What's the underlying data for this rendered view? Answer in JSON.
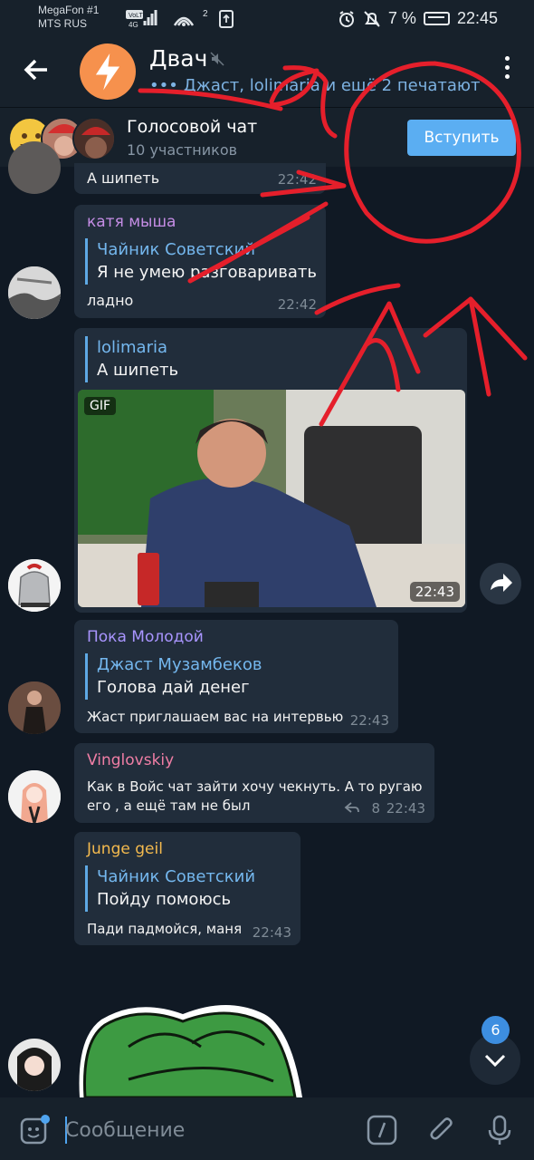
{
  "status_bar": {
    "carrier_1": "MegaFon #1",
    "carrier_2": "MTS RUS",
    "volte": "VoLTE",
    "network": "4G",
    "sim_badge": "2",
    "battery": "7 %",
    "time": "22:45"
  },
  "header": {
    "title": "Двач",
    "typing_status": "••• Джаст, lolimaria и ещё 2 печатают"
  },
  "voice_chat": {
    "title": "Голосовой чат",
    "participants": "10 участников",
    "join_label": "Вступить"
  },
  "messages": [
    {
      "id": "m0",
      "text": "А шипеть",
      "time": "22:42"
    },
    {
      "id": "m1",
      "sender": "катя мыша",
      "sender_color": "#c58de5",
      "quote_name": "Чайник Советский",
      "quote_text": "Я не умею разговаривать",
      "text": "ладно",
      "time": "22:42"
    },
    {
      "id": "m2",
      "quote_name": "lolimaria",
      "quote_text": "А шипеть",
      "media_label": "GIF",
      "time": "22:43"
    },
    {
      "id": "m3",
      "sender": "Пока Молодой",
      "sender_color": "#a995ff",
      "quote_name": "Джаст Музамбеков",
      "quote_text": "Голова дай денег",
      "text": "Жаст приглашаем вас на интервью",
      "time": "22:43"
    },
    {
      "id": "m4",
      "sender": "Vinglovskiy",
      "sender_color": "#f07ea5",
      "text_line_1": "Как в Войс чат зайти хочу чекнуть. А то ругаю",
      "text_line_2": "его , а ещё там не был",
      "replies": "8",
      "time": "22:43"
    },
    {
      "id": "m5",
      "sender": "Junge geil",
      "sender_color": "#f4ba4e",
      "quote_name": "Чайник Советский",
      "quote_text": "Пойду помоюсь",
      "text": "Пади падмойся, маня",
      "time": "22:43"
    }
  ],
  "scroll_button": {
    "unread_count": "6"
  },
  "composer": {
    "placeholder": "Сообщение"
  },
  "colors": {
    "background": "#101924",
    "bubble": "#212d3b",
    "header": "#17212b",
    "accent": "#5baef2",
    "annotation": "#e51f2b"
  }
}
